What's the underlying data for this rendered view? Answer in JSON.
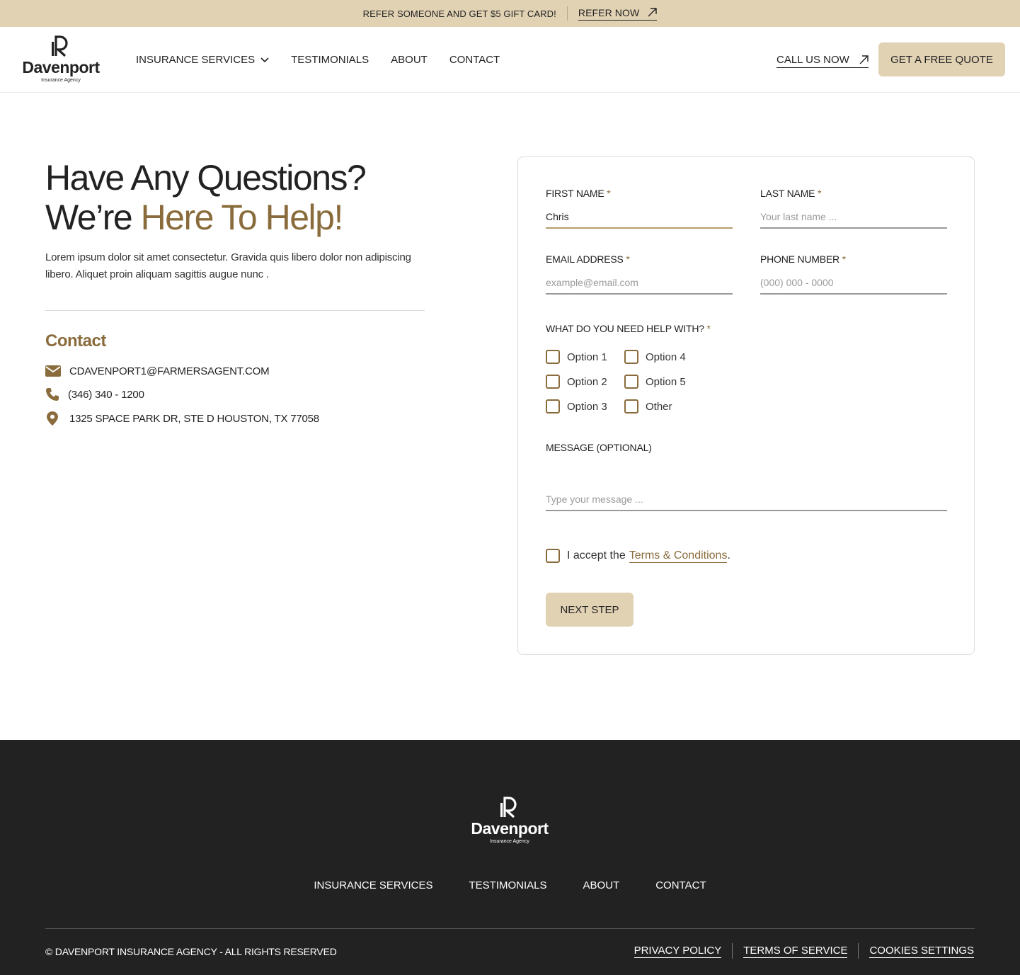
{
  "banner": {
    "promo": "REFER SOMEONE AND GET $5 GIFT CARD!",
    "refer_label": "REFER NOW"
  },
  "brand": {
    "name": "Davenport",
    "tagline": "Insurance Agency",
    "accent_color": "#8a6c3c",
    "sand_color": "#e2d2b4"
  },
  "header": {
    "nav": [
      "INSURANCE SERVICES",
      "TESTIMONIALS",
      "ABOUT",
      "CONTACT"
    ],
    "call_label": "CALL US NOW",
    "quote_label": "GET A FREE QUOTE"
  },
  "hero": {
    "title_line1": "Have Any Questions?",
    "title_line2_plain": "We’re ",
    "title_line2_accent": "Here To Help!",
    "lead": "Lorem ipsum dolor sit amet consectetur. Gravida quis libero dolor non adipiscing libero. Aliquet proin aliquam sagittis augue nunc ."
  },
  "contact": {
    "heading": "Contact",
    "email": "CDAVENPORT1@FARMERSAGENT.COM",
    "phone": "(346) 340 - 1200",
    "address": "1325 SPACE PARK DR, STE D HOUSTON, TX 77058"
  },
  "form": {
    "first_name": {
      "label": "FIRST NAME",
      "required": "*",
      "value": "Chris"
    },
    "last_name": {
      "label": "LAST NAME",
      "required": "*",
      "placeholder": "Your last name ..."
    },
    "email": {
      "label": "EMAIL ADDRESS",
      "required": "*",
      "placeholder": "example@email.com"
    },
    "phone": {
      "label": "PHONE NUMBER",
      "required": "*",
      "placeholder": "(000) 000 - 0000"
    },
    "help": {
      "label": "WHAT DO YOU NEED HELP WITH?",
      "required": "*",
      "options": [
        "Option 1",
        "Option 2",
        "Option 3",
        "Option 4",
        "Option 5",
        "Other"
      ]
    },
    "message": {
      "label": "MESSAGE (OPTIONAL)",
      "placeholder": "Type your message ..."
    },
    "terms": {
      "prefix": "I accept the",
      "link": "Terms & Conditions",
      "suffix": "."
    },
    "submit_label": "NEXT STEP"
  },
  "footer": {
    "nav": [
      "INSURANCE SERVICES",
      "TESTIMONIALS",
      "ABOUT",
      "CONTACT"
    ],
    "copyright": "© DAVENPORT INSURANCE AGENCY - ALL RIGHTS RESERVED",
    "legal": [
      "PRIVACY POLICY",
      "TERMS OF SERVICE",
      "COOKIES SETTINGS"
    ]
  }
}
